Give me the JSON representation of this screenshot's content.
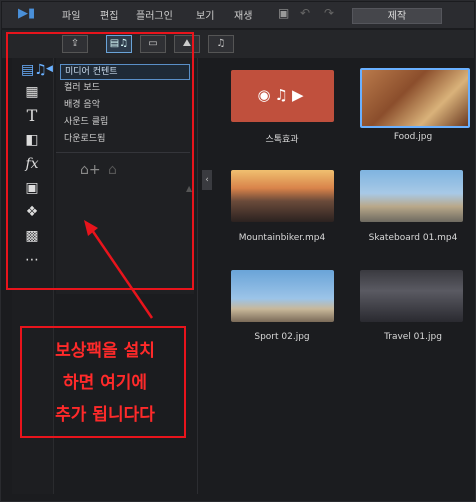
{
  "menubar": {
    "items": [
      "파일",
      "편집",
      "플러그인",
      "보기",
      "재생"
    ],
    "produce_label": "제작"
  },
  "tree": {
    "items": [
      "미디어 컨텐트",
      "컬러 보드",
      "배경 음악",
      "사운드 클립",
      "다운로드됨"
    ],
    "selected_index": 0
  },
  "media": [
    {
      "label": "스톡효과"
    },
    {
      "label": "Food.jpg"
    },
    {
      "label": "Mountainbiker.mp4"
    },
    {
      "label": "Skateboard 01.mp4"
    },
    {
      "label": "Sport 02.jpg"
    },
    {
      "label": "Travel 01.jpg"
    }
  ],
  "annotation": {
    "lines": [
      "보상팩을 설치",
      "하면 여기에",
      "추가 됩니다다"
    ],
    "color": "#e8141c"
  }
}
